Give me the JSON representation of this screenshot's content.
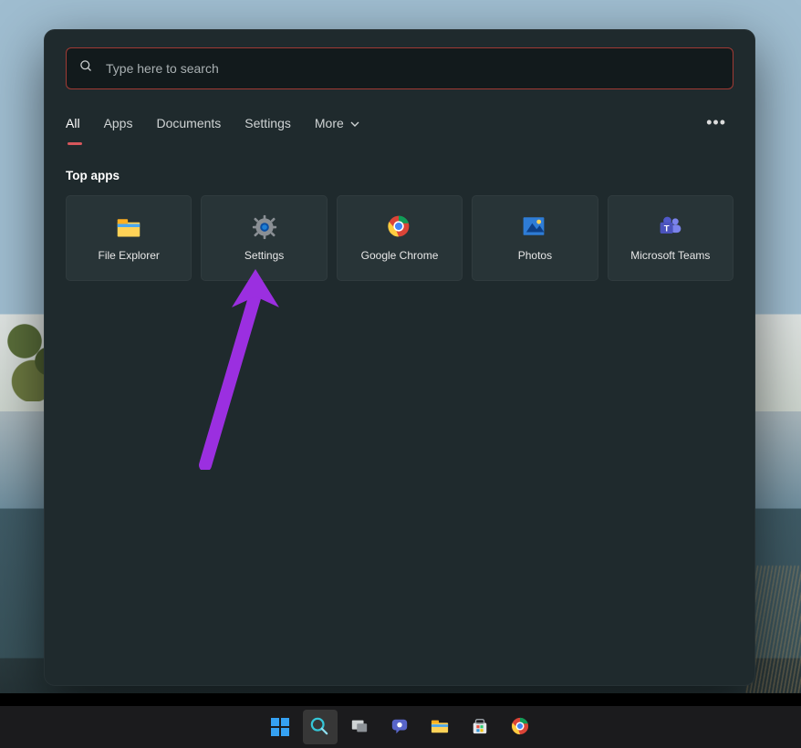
{
  "search": {
    "placeholder": "Type here to search"
  },
  "tabs": {
    "items": [
      "All",
      "Apps",
      "Documents",
      "Settings",
      "More"
    ],
    "active_index": 0
  },
  "section": {
    "title": "Top apps"
  },
  "apps": [
    {
      "id": "file-explorer",
      "label": "File Explorer",
      "icon": "folder-icon"
    },
    {
      "id": "settings",
      "label": "Settings",
      "icon": "gear-icon"
    },
    {
      "id": "google-chrome",
      "label": "Google Chrome",
      "icon": "chrome-icon"
    },
    {
      "id": "photos",
      "label": "Photos",
      "icon": "photos-icon"
    },
    {
      "id": "microsoft-teams",
      "label": "Microsoft Teams",
      "icon": "teams-icon"
    }
  ],
  "taskbar": [
    {
      "id": "start",
      "icon": "windows-icon",
      "active": false
    },
    {
      "id": "search",
      "icon": "search-icon",
      "active": true
    },
    {
      "id": "taskview",
      "icon": "taskview-icon",
      "active": false
    },
    {
      "id": "chat",
      "icon": "chat-icon",
      "active": false
    },
    {
      "id": "files",
      "icon": "folder-icon",
      "active": false
    },
    {
      "id": "store",
      "icon": "store-icon",
      "active": false
    },
    {
      "id": "chrome",
      "icon": "chrome-icon",
      "active": false
    }
  ],
  "annotation": {
    "target_app_id": "settings",
    "color": "#9b2fe0"
  }
}
